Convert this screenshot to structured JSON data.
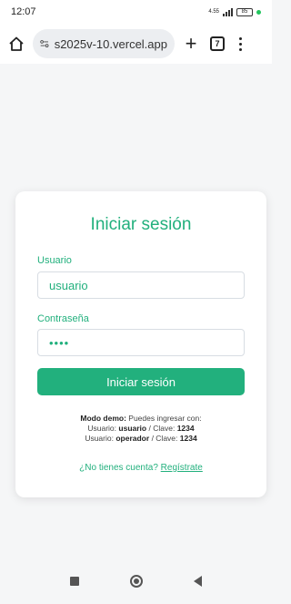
{
  "status_bar": {
    "time": "12:07",
    "network": "4.55",
    "battery": "85"
  },
  "browser": {
    "url": "s2025v-10.vercel.app",
    "tab_count": "7",
    "new_tab_symbol": "+"
  },
  "login": {
    "title": "Iniciar sesión",
    "username_label": "Usuario",
    "username_value": "usuario",
    "password_label": "Contraseña",
    "password_mask": "••••",
    "submit_label": "Iniciar sesión",
    "demo": {
      "heading": "Modo demo:",
      "intro": "Puedes ingresar con:",
      "line1_user_prefix": "Usuario:",
      "line1_user": "usuario",
      "line1_pass_prefix": "/ Clave:",
      "line1_pass": "1234",
      "line2_user_prefix": "Usuario:",
      "line2_user": "operador",
      "line2_pass_prefix": "/ Clave:",
      "line2_pass": "1234"
    },
    "register_prompt": "¿No tienes cuenta?",
    "register_link": "Regístrate"
  },
  "colors": {
    "accent": "#22b07d",
    "status_dot": "#22c55e"
  }
}
